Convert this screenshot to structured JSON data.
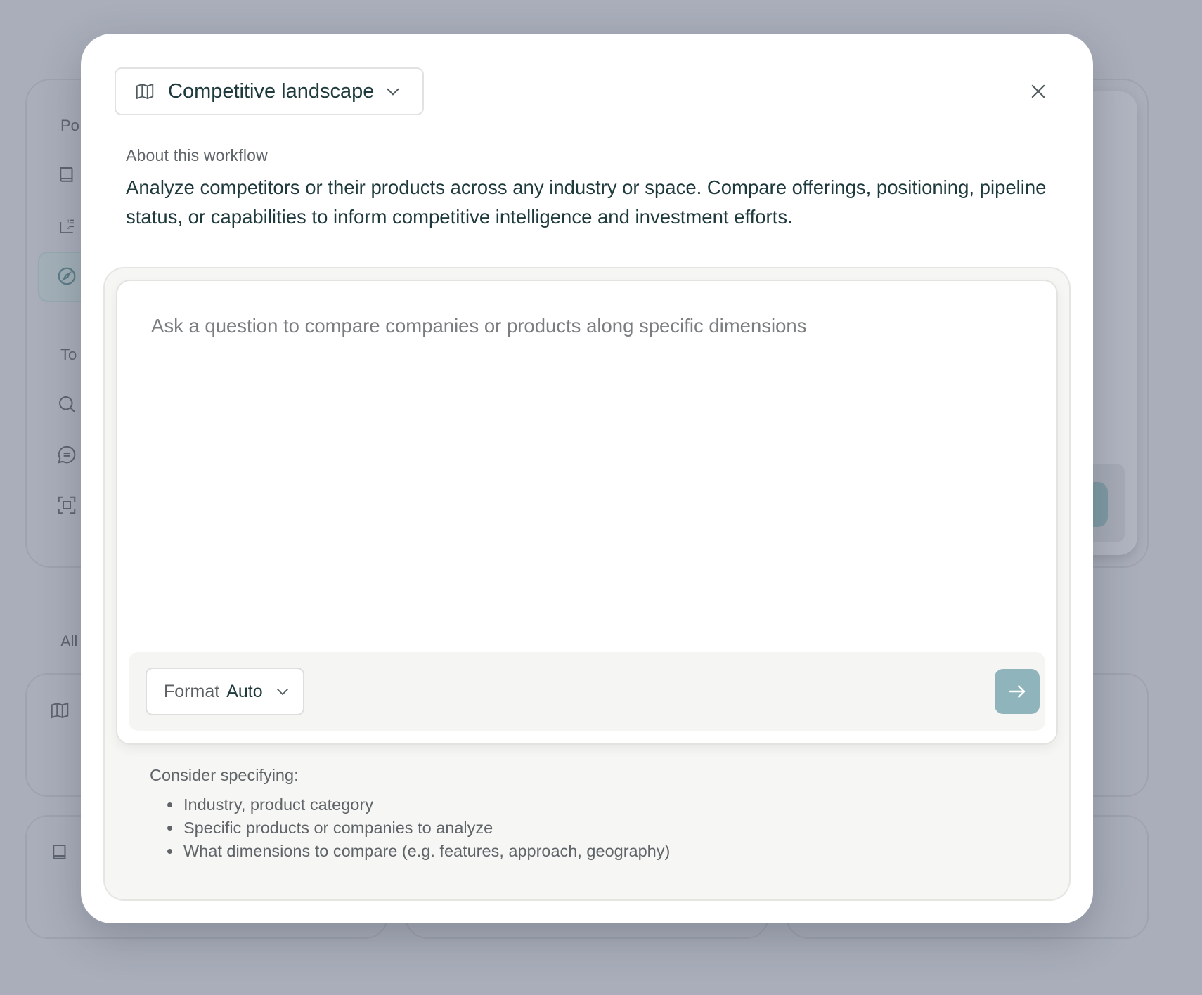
{
  "background": {
    "section_labels": [
      "Po",
      "To",
      "All"
    ],
    "nav_icons": [
      "book-icon",
      "numbered-list-icon",
      "compass-icon",
      "search-icon",
      "chat-icon",
      "scan-icon"
    ],
    "card_icons": [
      "map-icon",
      "book-icon"
    ]
  },
  "modal": {
    "workflow_select": {
      "icon": "map-icon",
      "label": "Competitive landscape"
    },
    "close_icon": "close-icon",
    "about": {
      "heading": "About this workflow",
      "description": "Analyze competitors or their products across any industry or space. Compare offerings, positioning, pipeline status, or capabilities to inform competitive intelligence and investment efforts."
    },
    "composer": {
      "placeholder": "Ask a question to compare companies or products along specific dimensions",
      "value": "",
      "format_label": "Format",
      "format_value": "Auto",
      "send_icon": "arrow-right-icon"
    },
    "tips": {
      "title": "Consider specifying:",
      "items": [
        "Industry, product category",
        "Specific products or companies to analyze",
        "What dimensions to compare (e.g. features, approach, geography)"
      ]
    }
  },
  "colors": {
    "overlay": "#a9aeba",
    "text_primary": "#1f3a3d",
    "text_muted": "#5f6468",
    "send_button": "#8fb4bb"
  }
}
